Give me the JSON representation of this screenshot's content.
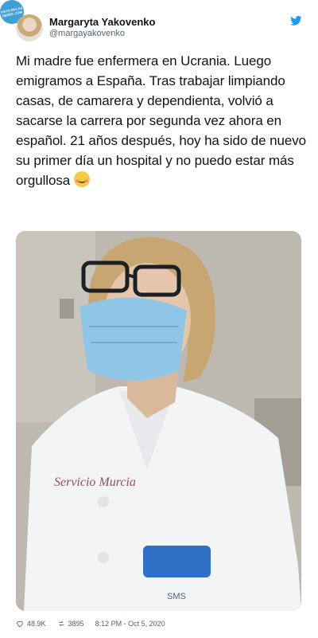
{
  "watermark": {
    "text": "VISTO EN LAS REDES .COM"
  },
  "author": {
    "name": "Margaryta Yakovenko",
    "handle": "@margayakovenko",
    "avatar_icon": "avatar-photo"
  },
  "tweet": {
    "text": "Mi madre fue enfermera en Ucrania. Luego emigramos a España. Tras trabajar limpiando casas, de camarera y dependienta, volvió a sacarse la carrera por segunda vez ahora en español. 21 años después, hoy ha sido de nuevo su primer día un hospital y no puedo estar más orgullosa",
    "emoji": "smiling-face-with-blush-emoji"
  },
  "photo": {
    "uniform_text": "Servicio Murcia",
    "badge_text": "SMS"
  },
  "stats": {
    "likes": "48.9K",
    "retweets": "3895",
    "time": "8:12 PM - Oct 5, 2020"
  },
  "colors": {
    "brand_blue": "#1d9bf0",
    "text": "#0f1419",
    "muted": "#536471",
    "mask": "#8fc6e8",
    "pocket": "#2f6fc4"
  }
}
